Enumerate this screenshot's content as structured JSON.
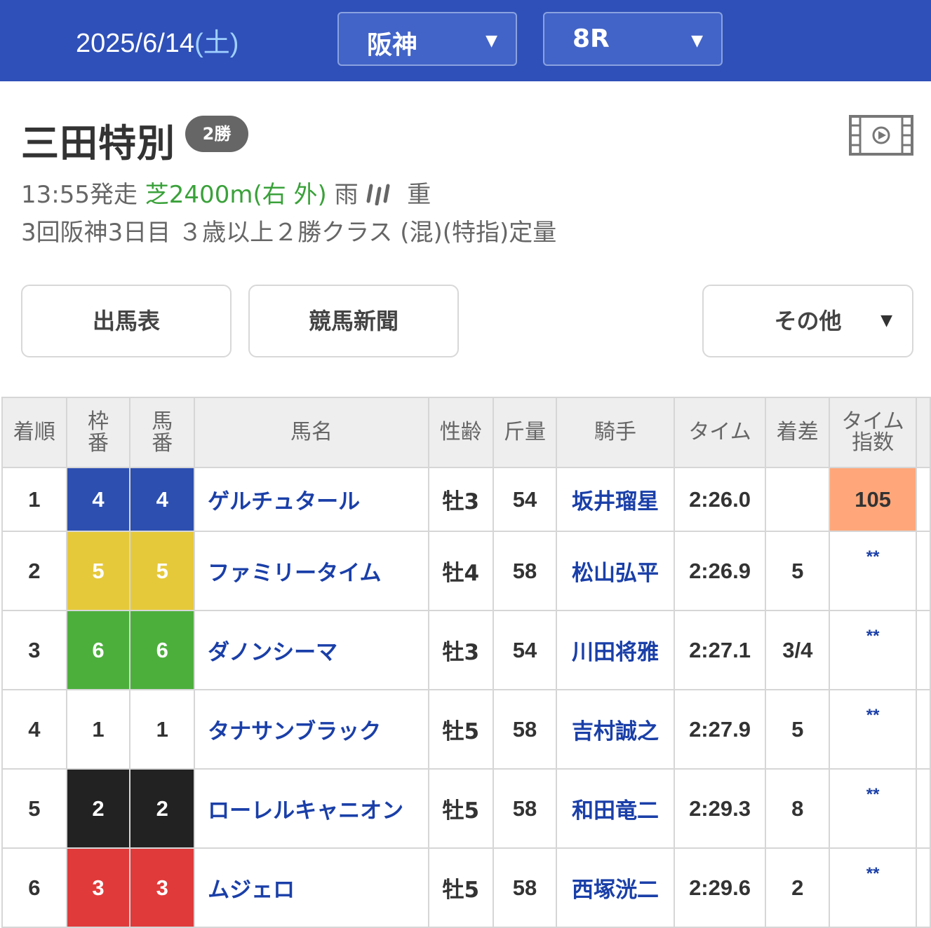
{
  "header": {
    "date": "2025/6/14",
    "weekday": "(土)",
    "venue_select": "阪神",
    "race_select": "8R"
  },
  "race": {
    "name": "三田特別",
    "class_badge": "2勝",
    "start_time": "13:55発走",
    "course": "芝2400m(右 外)",
    "weather": "雨",
    "track_condition": "重",
    "details": "3回阪神3日目 ３歳以上２勝クラス (混)(特指)定量"
  },
  "buttons": {
    "entries": "出馬表",
    "newspaper": "競馬新聞",
    "other": "その他"
  },
  "table": {
    "headers": {
      "rank": "着順",
      "frame": "枠番",
      "number": "馬番",
      "horse": "馬名",
      "sex_age": "性齢",
      "weight": "斤量",
      "jockey": "騎手",
      "time": "タイム",
      "margin": "着差",
      "time_index": "タイム指数"
    },
    "rows": [
      {
        "rank": "1",
        "frame": "4",
        "number": "4",
        "horse": "ゲルチュタール",
        "sex_age": "牡3",
        "weight": "54",
        "jockey": "坂井瑠星",
        "time": "2:26.0",
        "margin": "",
        "index": "105",
        "frame_bg": "#2c4fb0",
        "frame_fg": "#ffffff",
        "index_bg": "#ffa77a"
      },
      {
        "rank": "2",
        "frame": "5",
        "number": "5",
        "horse": "ファミリータイム",
        "sex_age": "牡4",
        "weight": "58",
        "jockey": "松山弘平",
        "time": "2:26.9",
        "margin": "5",
        "index": "**",
        "frame_bg": "#e6c93a",
        "frame_fg": "#ffffff",
        "index_bg": ""
      },
      {
        "rank": "3",
        "frame": "6",
        "number": "6",
        "horse": "ダノンシーマ",
        "sex_age": "牡3",
        "weight": "54",
        "jockey": "川田将雅",
        "time": "2:27.1",
        "margin": "3/4",
        "index": "**",
        "frame_bg": "#4caf3c",
        "frame_fg": "#ffffff",
        "index_bg": ""
      },
      {
        "rank": "4",
        "frame": "1",
        "number": "1",
        "horse": "タナサンブラック",
        "sex_age": "牡5",
        "weight": "58",
        "jockey": "吉村誠之",
        "time": "2:27.9",
        "margin": "5",
        "index": "**",
        "frame_bg": "#ffffff",
        "frame_fg": "#333333",
        "index_bg": ""
      },
      {
        "rank": "5",
        "frame": "2",
        "number": "2",
        "horse": "ローレルキャニオン",
        "sex_age": "牡5",
        "weight": "58",
        "jockey": "和田竜二",
        "time": "2:29.3",
        "margin": "8",
        "index": "**",
        "frame_bg": "#222222",
        "frame_fg": "#ffffff",
        "index_bg": ""
      },
      {
        "rank": "6",
        "frame": "3",
        "number": "3",
        "horse": "ムジェロ",
        "sex_age": "牡5",
        "weight": "58",
        "jockey": "西塚洸二",
        "time": "2:29.6",
        "margin": "2",
        "index": "**",
        "frame_bg": "#e03a3a",
        "frame_fg": "#ffffff",
        "index_bg": ""
      }
    ]
  }
}
